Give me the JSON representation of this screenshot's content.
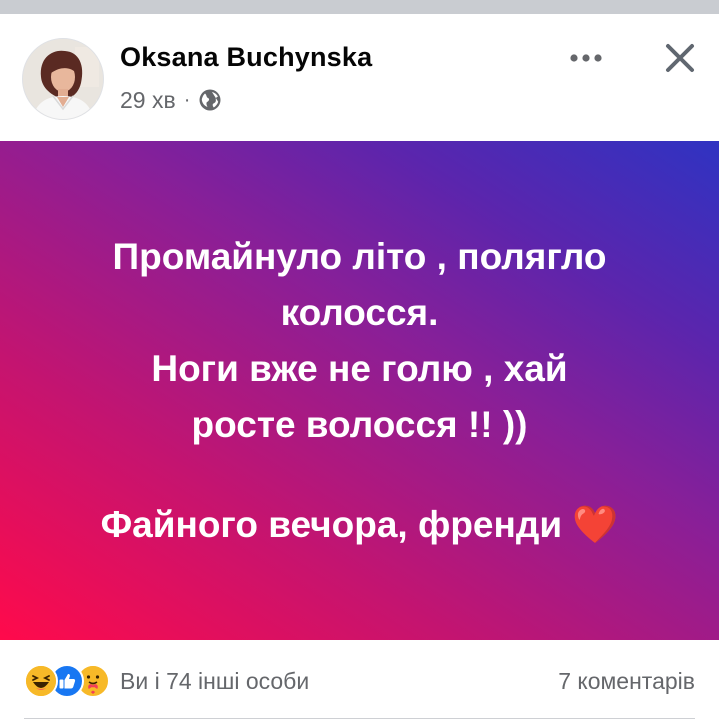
{
  "post": {
    "author": "Oksana Buchynska",
    "time": "29 хв",
    "separator": "·",
    "privacy_icon": "globe-icon",
    "text_lines": [
      "Промайнуло літо , полягло",
      "колосся.",
      "Ноги вже не голю , хай",
      "росте волосся !! ))"
    ],
    "closing_line": "Файного вечора, френди ❤️",
    "background_colors": [
      "#ff0a4b",
      "#8a1f97",
      "#2f33c2"
    ]
  },
  "header_actions": {
    "more_icon": "more-dots-icon",
    "close_icon": "close-icon"
  },
  "footer": {
    "reactions": [
      "haha",
      "like",
      "care"
    ],
    "reactions_text": "Ви і 74 інші особи",
    "comments_text": "7 коментарів"
  }
}
